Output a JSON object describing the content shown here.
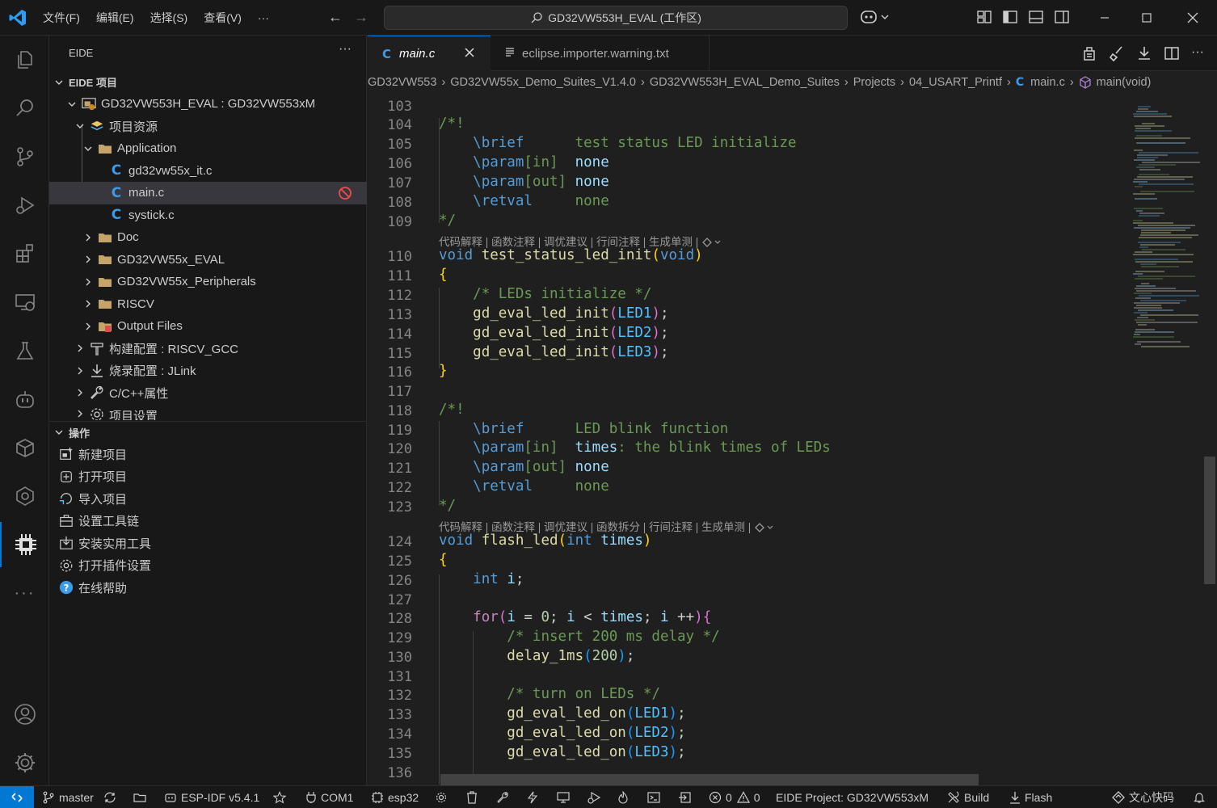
{
  "titlebar": {
    "menus": [
      "文件(F)",
      "编辑(E)",
      "选择(S)",
      "查看(V)",
      "···"
    ],
    "search": "GD32VW553H_EVAL (工作区)"
  },
  "sidebar": {
    "title": "EIDE",
    "more": "···",
    "project_section": "EIDE 项目",
    "tree": [
      {
        "label": "GD32VW553H_EVAL : GD32VW553xM"
      },
      {
        "label": "项目资源"
      },
      {
        "label": "Application"
      },
      {
        "label": "gd32vw55x_it.c"
      },
      {
        "label": "main.c"
      },
      {
        "label": "systick.c"
      },
      {
        "label": "Doc"
      },
      {
        "label": "GD32VW55x_EVAL"
      },
      {
        "label": "GD32VW55x_Peripherals"
      },
      {
        "label": "RISCV"
      },
      {
        "label": "Output Files"
      },
      {
        "label": "构建配置 : RISCV_GCC"
      },
      {
        "label": "烧录配置 : JLink"
      },
      {
        "label": "C/C++属性"
      },
      {
        "label": "项目设置"
      }
    ],
    "ops_section": "操作",
    "ops": [
      "新建项目",
      "打开项目",
      "导入项目",
      "设置工具链",
      "安装实用工具",
      "打开插件设置",
      "在线帮助"
    ]
  },
  "tabs": [
    {
      "label": "main.c",
      "icon": "C"
    },
    {
      "label": "eclipse.importer.warning.txt"
    }
  ],
  "breadcrumb": [
    "GD32VW553",
    "GD32VW55x_Demo_Suites_V1.4.0",
    "GD32VW553H_EVAL_Demo_Suites",
    "Projects",
    "04_USART_Printf",
    "main.c",
    "main(void)"
  ],
  "code": {
    "lines": [
      "103",
      "104",
      "105",
      "106",
      "107",
      "108",
      "109",
      "110",
      "111",
      "112",
      "113",
      "114",
      "115",
      "116",
      "117",
      "118",
      "119",
      "120",
      "121",
      "122",
      "123",
      "124",
      "125",
      "126",
      "127",
      "128",
      "129",
      "130",
      "131",
      "132",
      "133",
      "134",
      "135",
      "136"
    ],
    "lens1": "代码解释 | 函数注释 | 调优建议 | 行间注释 | 生成单测 |",
    "lens2": "代码解释 | 函数注释 | 调优建议 | 函数拆分 | 行间注释 | 生成单测 |"
  },
  "status": {
    "branch": "master",
    "espidf": "ESP-IDF v5.4.1",
    "com": "COM1",
    "target": "esp32",
    "errors": "0",
    "warnings": "0",
    "project": "EIDE Project: GD32VW553xM",
    "build": "Build",
    "flash": "Flash",
    "ai": "文心快码"
  },
  "colors": {
    "accent": "#0078d4",
    "bg": "#1f1f1f",
    "panel": "#181818"
  }
}
